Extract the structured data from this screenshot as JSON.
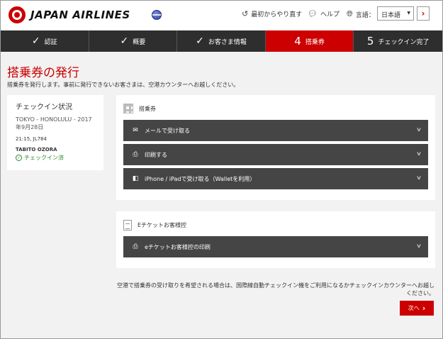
{
  "header": {
    "brand": "JAPAN AIRLINES",
    "restart_label": "最初からやり直す",
    "help_label": "ヘルプ",
    "language_label": "言語：",
    "language_value": "日本語",
    "next_glyph": "›"
  },
  "steps": [
    {
      "marker": "✓",
      "label": "認証",
      "active": false
    },
    {
      "marker": "✓",
      "label": "概要",
      "active": false
    },
    {
      "marker": "✓",
      "label": "お客さま情報",
      "active": false
    },
    {
      "marker": "4",
      "label": "搭乗券",
      "active": true
    },
    {
      "marker": "5",
      "label": "チェックイン完了",
      "active": false
    }
  ],
  "page": {
    "title": "搭乗券の発行",
    "subtitle": "搭乗券を発行します。事前に発行できないお客さまは、空港カウンターへお越しください。"
  },
  "status": {
    "heading": "チェックイン状況",
    "route": "TOKYO - HONOLULU - 2017年9月28日",
    "flight": "21:15, JL784",
    "passenger": "TABITO OZORA",
    "state": "チェックイン済"
  },
  "boarding_pass": {
    "heading": "搭乗券",
    "options": [
      {
        "icon": "mail-icon",
        "glyph": "✉",
        "label": "メールで受け取る"
      },
      {
        "icon": "printer-icon",
        "glyph": "⎙",
        "label": "印刷する"
      },
      {
        "icon": "wallet-icon",
        "glyph": "◧",
        "label": "iPhone / iPadで受け取る（Walletを利用）"
      }
    ]
  },
  "eticket": {
    "heading": "Eチケットお客様控",
    "options": [
      {
        "icon": "printer-icon",
        "glyph": "⎙",
        "label": "eチケットお客様控の印刷"
      }
    ]
  },
  "footer": {
    "note": "空港で搭乗券の受け取りを希望される場合は、国際線自動チェックイン機をご利用になるかチェックインカウンターへお越しください。",
    "next_label": "次へ",
    "next_arrow": "›"
  },
  "colors": {
    "accent": "#cc0000",
    "dark_bar": "#2e2e2e",
    "option_bg": "#454545",
    "success": "#2e8b2e"
  }
}
